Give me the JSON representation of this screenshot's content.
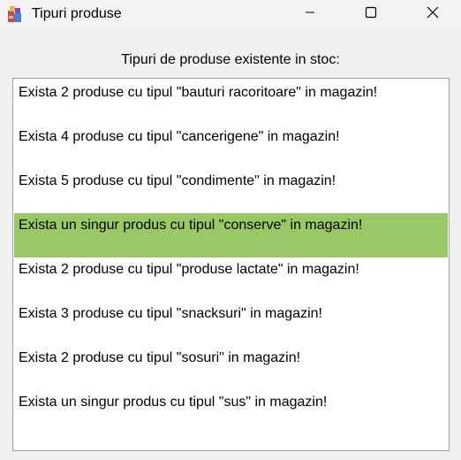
{
  "window": {
    "title": "Tipuri produse",
    "app_icon": "stacked-products-icon"
  },
  "controls": {
    "minimize_icon": "minimize-icon",
    "maximize_icon": "maximize-icon",
    "close_icon": "close-icon"
  },
  "main": {
    "heading": "Tipuri de produse existente in stoc:",
    "selected_index": 3,
    "selected_color": "#9bc867",
    "items": [
      "Exista 2 produse cu tipul \"bauturi racoritoare\" in magazin!",
      "Exista 4 produse cu tipul \"cancerigene\" in magazin!",
      "Exista 5 produse cu tipul \"condimente\" in magazin!",
      "Exista un singur produs cu tipul \"conserve\" in magazin!",
      "Exista 2 produse cu tipul \"produse lactate\" in magazin!",
      "Exista 3 produse cu tipul \"snacksuri\" in magazin!",
      "Exista 2 produse cu tipul \"sosuri\" in magazin!",
      "Exista un singur produs cu tipul \"sus\" in magazin!"
    ]
  }
}
